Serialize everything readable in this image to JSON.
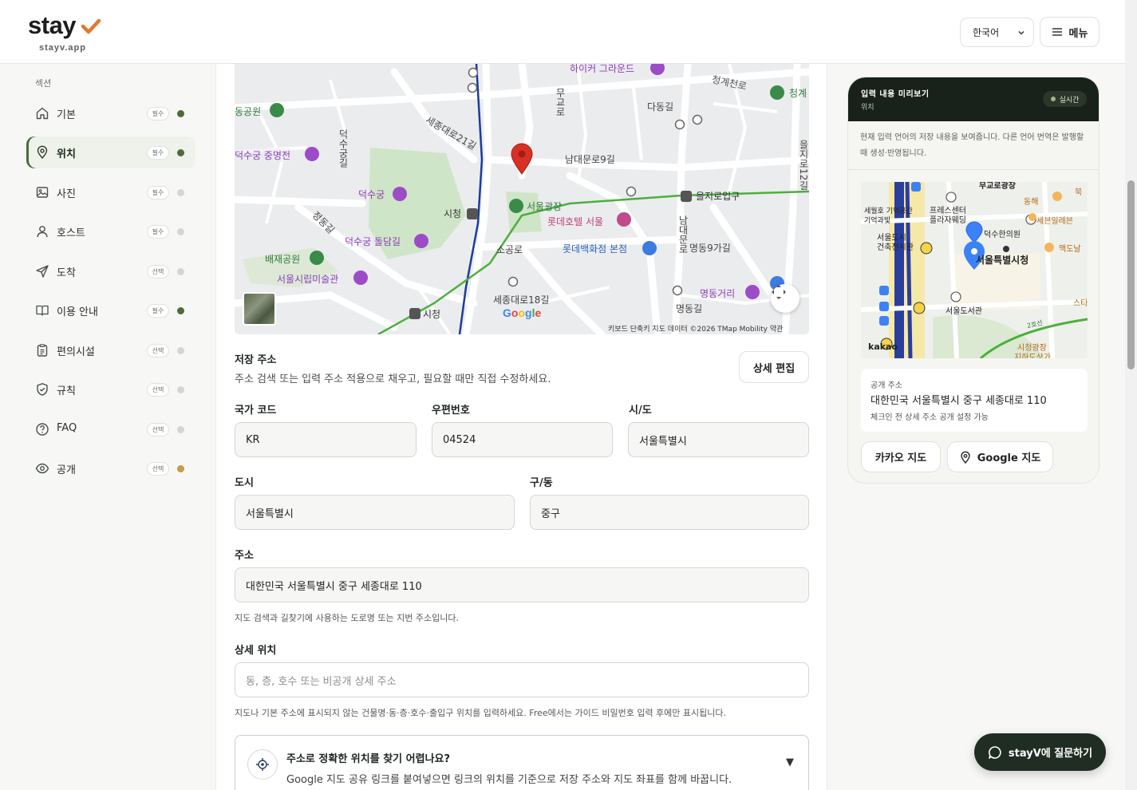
{
  "header": {
    "logo_text": "stay",
    "logo_sub": "stayv.app",
    "language": "한국어",
    "menu_label": "메뉴"
  },
  "sidebar": {
    "section_label": "섹션",
    "items": [
      {
        "label": "기본",
        "badge": "필수",
        "dot": "#4d6b3c"
      },
      {
        "label": "위치",
        "badge": "필수",
        "dot": "#4d6b3c"
      },
      {
        "label": "사진",
        "badge": "필수",
        "dot": "#d3d6d1"
      },
      {
        "label": "호스트",
        "badge": "필수",
        "dot": "#d3d6d1"
      },
      {
        "label": "도착",
        "badge": "선택",
        "dot": "#d3d6d1"
      },
      {
        "label": "이용 안내",
        "badge": "필수",
        "dot": "#4d6b3c"
      },
      {
        "label": "편의시설",
        "badge": "선택",
        "dot": "#d3d6d1"
      },
      {
        "label": "규칙",
        "badge": "선택",
        "dot": "#d3d6d1"
      },
      {
        "label": "FAQ",
        "badge": "선택",
        "dot": "#d3d6d1"
      },
      {
        "label": "공개",
        "badge": "선택",
        "dot": "#c99a3f"
      }
    ]
  },
  "map": {
    "labels": {
      "hikerground": "하이커 그라운드",
      "cheonggyecheon": "청계천로",
      "cheonggye2": "청계",
      "donggongwon": "동공원",
      "dadonggil": "다동길",
      "mugyo": "무교로",
      "sejongdaero21": "세종대로21길",
      "deoksugung_jm": "덕수궁 중명전",
      "deoksugunggil": "덕수궁길",
      "deoksugung": "덕수궁",
      "namdaemunro9": "남대문로9길",
      "euljiro": "을지로입구",
      "cityhall_st": "시청",
      "seoulplaza": "서울광장",
      "lotte_hotel": "롯데호텔 서울",
      "jeongdonggil": "정동길",
      "deoksugung_dolldam": "덕수궁 돌담길",
      "sogongro": "소공로",
      "lotte_dept": "롯데백화점 본점",
      "myeongdong9": "명동9가길",
      "baejae": "배재공원",
      "seoul_museum": "서울시립미술관",
      "sejongdaero18": "세종대로18길",
      "myeongdonggeori": "명동거리",
      "myeongdonggil": "명동길",
      "cityhall2": "시청",
      "namdaemunro": "남대문로",
      "euljiro_side": "을지로12길",
      "google": "Google",
      "footer": "키보드 단축키   지도 데이터 ©2026 TMap Mobility   약관"
    }
  },
  "saved_address": {
    "title": "저장 주소",
    "help": "주소 검색 또는 입력 주소 적용으로 채우고, 필요할 때만 직접 수정하세요.",
    "edit_button": "상세 편집"
  },
  "fields": {
    "country_label": "국가 코드",
    "country_value": "KR",
    "postal_label": "우편번호",
    "postal_value": "04524",
    "state_label": "시/도",
    "state_value": "서울특별시",
    "city_label": "도시",
    "city_value": "서울특별시",
    "district_label": "구/동",
    "district_value": "중구",
    "address_label": "주소",
    "address_value": "대한민국 서울특별시 중구 세종대로 110",
    "address_help": "지도 검색과 길찾기에 사용하는 도로명 또는 지번 주소입니다.",
    "detail_label": "상세 위치",
    "detail_placeholder": "동, 층, 호수 또는 비공개 상세 주소",
    "detail_help": "지도나 기본 주소에 표시되지 않는 건물명·동·층·호수·출입구 위치를 입력하세요. Free에서는 가이드 비밀번호 입력 후에만 표시됩니다."
  },
  "collapse": {
    "title": "주소로 정확한 위치를 찾기 어렵나요?",
    "desc": "Google 지도 공유 링크를 붙여넣으면 링크의 위치를 기준으로 저장 주소와 지도 좌표를 함께 바꿉니다."
  },
  "preview": {
    "title": "입력 내용 미리보기",
    "subtitle": "위치",
    "live": "실시간",
    "note": "현재 입력 언어의 저장 내용을 보여줍니다. 다른 언어 번역은 발행할 때 생성·반영됩니다.",
    "map_labels": {
      "seoul_plaza_top": "무교로광장",
      "donghae": "동해",
      "buk": "북",
      "sewol": "세월호 기억공간",
      "sewol2": "기억과빛",
      "press": "프레스센터",
      "press2": "플라자웨딩",
      "sebeol": "세븐일레븐",
      "seoul_doshi": "서울도시",
      "seoul_doshi2": "건축전시관",
      "deoksu_hospital": "덕수한의원",
      "cityhall": "서울특별시청",
      "mackdo": "맥도날",
      "library": "서울도서관",
      "star": "스타",
      "cityplaza": "시청광장",
      "underground": "지하도상가",
      "kakao": "kakao",
      "line2": "2호선"
    },
    "public_addr_label": "공개 주소",
    "public_addr_value": "대한민국 서울특별시 중구 세종대로 110",
    "public_addr_note": "체크인 전 상세 주소 공개 설정 가능",
    "kakao_button": "카카오 지도",
    "google_button": "Google 지도"
  },
  "chat_button": "stayV에 질문하기"
}
